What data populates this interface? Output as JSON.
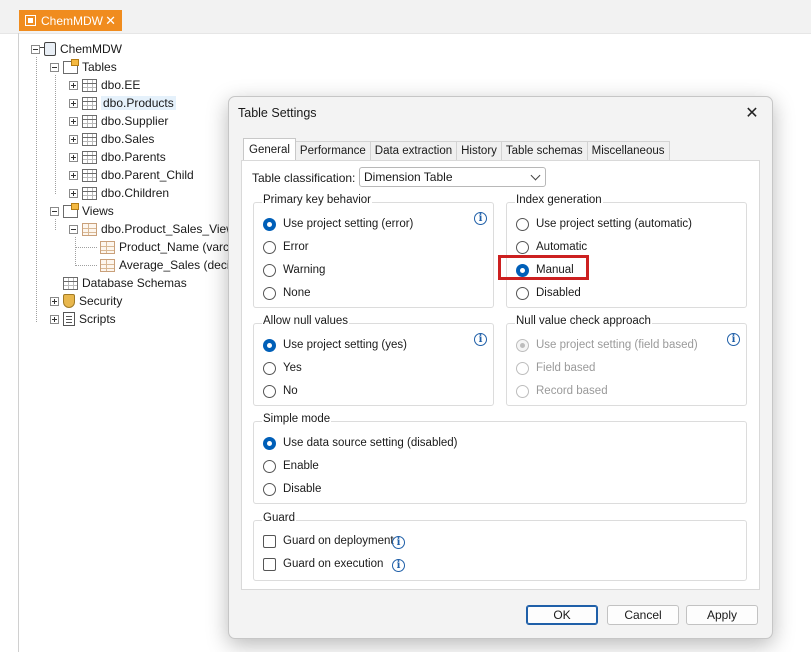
{
  "doc_tab": {
    "label": "ChemMDW",
    "close": "✕"
  },
  "tree": {
    "root": "ChemMDW",
    "tables": "Tables",
    "table_items": [
      "dbo.EE",
      "dbo.Products",
      "dbo.Supplier",
      "dbo.Sales",
      "dbo.Parents",
      "dbo.Parent_Child",
      "dbo.Children"
    ],
    "views": "Views",
    "view_item": "dbo.Product_Sales_View",
    "view_columns": [
      "Product_Name (varcha",
      "Average_Sales (decim"
    ],
    "database_schemas": "Database Schemas",
    "security": "Security",
    "scripts": "Scripts"
  },
  "dialog": {
    "title": "Table Settings",
    "close": "✕",
    "tabs": [
      "General",
      "Performance",
      "Data extraction",
      "History",
      "Table schemas",
      "Miscellaneous"
    ],
    "active_tab": "General",
    "classification_label": "Table classification:",
    "classification_value": "Dimension Table",
    "primary_key": {
      "title": "Primary key behavior",
      "options": [
        "Use project setting (error)",
        "Error",
        "Warning",
        "None"
      ],
      "selected": "Use project setting (error)"
    },
    "index_generation": {
      "title": "Index generation",
      "options": [
        "Use project setting (automatic)",
        "Automatic",
        "Manual",
        "Disabled"
      ],
      "selected": "Manual",
      "highlighted": "Manual"
    },
    "allow_null": {
      "title": "Allow null values",
      "options": [
        "Use project setting (yes)",
        "Yes",
        "No"
      ],
      "selected": "Use project setting (yes)"
    },
    "null_check": {
      "title": "Null value check approach",
      "options": [
        "Use project setting (field based)",
        "Field based",
        "Record based"
      ],
      "selected": "Use project setting (field based)",
      "disabled": true
    },
    "simple_mode": {
      "title": "Simple mode",
      "options": [
        "Use data source setting (disabled)",
        "Enable",
        "Disable"
      ],
      "selected": "Use data source setting (disabled)"
    },
    "guard": {
      "title": "Guard",
      "options": [
        "Guard on deployment",
        "Guard on execution"
      ],
      "checked": [
        false,
        false
      ]
    },
    "buttons": {
      "ok": "OK",
      "cancel": "Cancel",
      "apply": "Apply"
    },
    "info_glyph": "i"
  },
  "colors": {
    "tab_orange": "#f08c1e",
    "accent_blue": "#005fb8",
    "highlight_red": "#cc2020"
  }
}
